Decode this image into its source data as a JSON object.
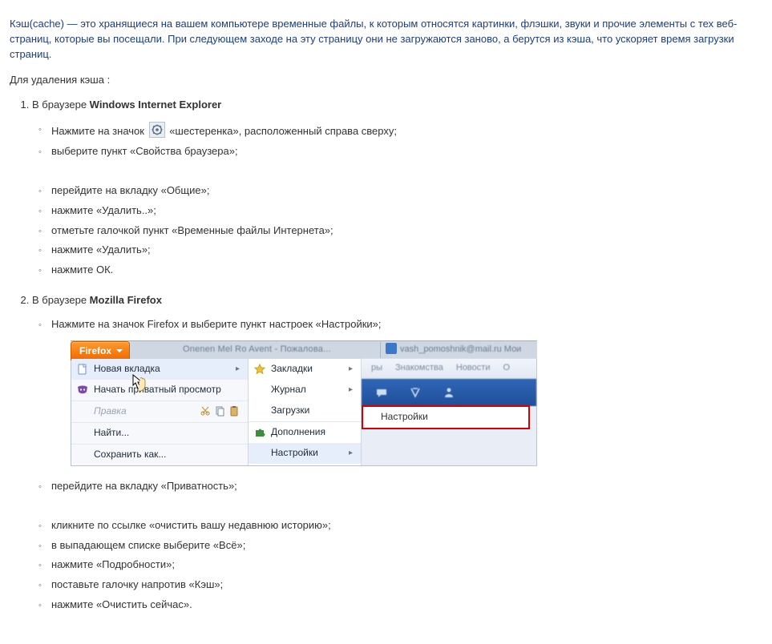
{
  "intro": "Кэш(cache) — это хранящиеся на вашем компьютере временные файлы, к которым относятся картинки, флэшки, звуки и прочие элементы с тех веб-страниц, которые вы посещали. При следующем заходе на эту страницу они не загружаются заново, а берутся из кэша, что ускоряет время загрузки страниц.",
  "lead2": "Для удаления кэша :",
  "ie": {
    "prefix": "В браузере ",
    "name": "Windows Internet Explorer",
    "steps_a": [
      {
        "pre": "Нажмите на значок ",
        "post": "«шестеренка», расположенный справа сверху;"
      },
      {
        "pre": "выберите пункт «Свойства браузера»;"
      }
    ],
    "steps_b": [
      "перейдите на вкладку «Общие»;",
      "нажмите «Удалить..»;",
      "отметьте галочкой пункт «Временные файлы Интернета»;",
      "нажмите «Удалить»;",
      "нажмите ОК."
    ]
  },
  "ff": {
    "prefix": "В браузере ",
    "name": "Mozilla Firefox",
    "step1": "Нажмите на значок Firefox и выберите пункт настроек «Настройки»;",
    "menu": {
      "button": "Firefox",
      "tab1_blur": "Onenen Mel Ro Avent - Пожалова...",
      "tab2_blur": "vash_pomoshnik@mail.ru Мои теле...",
      "col1": {
        "new_tab": "Новая вкладка",
        "private": "Начать приватный просмотр",
        "edit": "Правка",
        "find": "Найти...",
        "saveas": "Сохранить как..."
      },
      "col2": {
        "bookmarks": "Закладки",
        "journal": "Журнал",
        "downloads": "Загрузки",
        "addons": "Дополнения",
        "settings": "Настройки"
      },
      "blur_nav": {
        "a": "ры",
        "b": "Знакомства",
        "c": "Новости",
        "d": "О"
      },
      "red_label": "Настройки"
    },
    "steps_c": [
      "перейдите на вкладку «Приватность»;"
    ],
    "steps_d": [
      "кликните по ссылке «очистить вашу недавнюю историю»;",
      "в выпадающем списке выберите «Всё»;",
      "нажмите «Подробности»;",
      "поставьте галочку напротив «Кэш»;",
      "нажмите «Очистить сейчас»."
    ]
  }
}
